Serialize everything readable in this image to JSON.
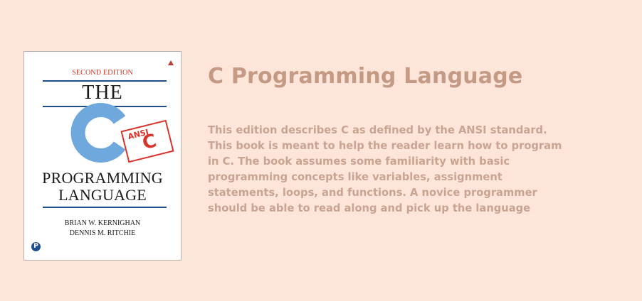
{
  "book": {
    "cover": {
      "edition": "SECOND EDITION",
      "title_line1": "THE",
      "title_big_letter": "C",
      "badge_top": "ANSI",
      "badge_letter": "C",
      "title_line2": "PROGRAMMING",
      "title_line3": "LANGUAGE",
      "author1": "BRIAN W. KERNIGHAN",
      "author2": "DENNIS M. RITCHIE",
      "publisher_mark": "P",
      "icon": "book-cover-icon"
    },
    "title": "C Programming Language",
    "description": "This edition describes C as defined by the ANSI standard.\nThis book is meant to help the reader learn how to program\nin C. The book assumes some familiarity with basic\nprogramming concepts like variables, assignment\nstatements, loops, and functions. A novice programmer\nshould be able to read along and pick up the language"
  },
  "colors": {
    "background": "#fde5da",
    "title": "#c49a84",
    "description": "#c8a491",
    "cover_blue": "#6fa8dc",
    "cover_red": "#d9342b"
  }
}
